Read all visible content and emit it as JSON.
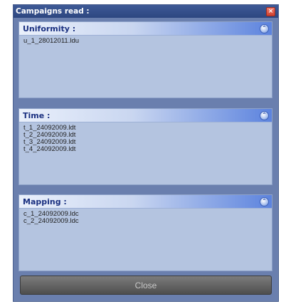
{
  "window": {
    "title": "Campaigns read :",
    "close_glyph": "×"
  },
  "panels": [
    {
      "title": "Uniformity :",
      "collapse_glyph": "⌃",
      "items": [
        "u_1_28012011.ldu"
      ]
    },
    {
      "title": "Time :",
      "collapse_glyph": "⌃",
      "items": [
        "t_1_24092009.ldt",
        "t_2_24092009.ldt",
        "t_3_24092009.ldt",
        "t_4_24092009.ldt"
      ]
    },
    {
      "title": "Mapping :",
      "collapse_glyph": "⌃",
      "items": [
        "c_1_24092009.ldc",
        "c_2_24092009.ldc"
      ]
    }
  ],
  "footer": {
    "close_label": "Close"
  },
  "colors": {
    "accent": "#2d4680",
    "panel_bg": "#b4c4e0",
    "header_blue": "#5c83de"
  }
}
